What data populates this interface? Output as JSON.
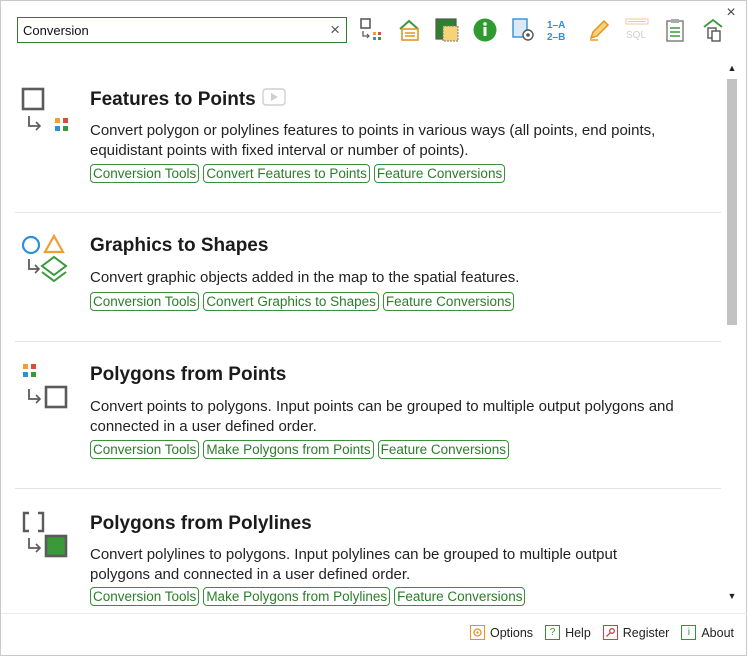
{
  "window": {
    "close_glyph": "×"
  },
  "search": {
    "value": "Conversion",
    "clear_glyph": "×"
  },
  "toolbar": {
    "buttons": [
      {
        "name": "features-to-points-tool-icon"
      },
      {
        "name": "export-layer-icon"
      },
      {
        "name": "map-extent-icon"
      },
      {
        "name": "info-icon"
      },
      {
        "name": "settings-document-icon"
      },
      {
        "name": "numbering-icon",
        "line1": "1–A",
        "line2": "2–B"
      },
      {
        "name": "pencil-edit-icon"
      },
      {
        "name": "sql-icon",
        "text": "SQL"
      },
      {
        "name": "clipboard-icon"
      },
      {
        "name": "copy-layer-icon"
      }
    ]
  },
  "results": [
    {
      "title": "Features to Points",
      "description": "Convert polygon or polylines features to points in various ways (all points, end points, equidistant points with fixed interval or number of points).",
      "tags": [
        "Conversion Tools",
        "Convert Features to Points",
        "Feature Conversions"
      ],
      "icon": "features-to-points-icon",
      "has_video": true
    },
    {
      "title": "Graphics to Shapes",
      "description": "Convert graphic objects added in the map to the spatial features.",
      "tags": [
        "Conversion Tools",
        "Convert Graphics to Shapes",
        "Feature Conversions"
      ],
      "icon": "graphics-to-shapes-icon",
      "has_video": false
    },
    {
      "title": "Polygons from Points",
      "description": "Convert points to polygons. Input points can be grouped to multiple output polygons and connected in a user defined order.",
      "tags": [
        "Conversion Tools",
        "Make Polygons from Points",
        "Feature Conversions"
      ],
      "icon": "polygons-from-points-icon",
      "has_video": false
    },
    {
      "title": "Polygons from Polylines",
      "description": "Convert polylines to polygons. Input polylines can be grouped to multiple output polygons and connected in a user defined order.",
      "tags": [
        "Conversion Tools",
        "Make Polygons from Polylines",
        "Feature Conversions"
      ],
      "icon": "polygons-from-polylines-icon",
      "has_video": false
    }
  ],
  "scrollbar": {
    "up_glyph": "▲",
    "down_glyph": "▼"
  },
  "footer": {
    "options": "Options",
    "help": "Help",
    "register": "Register",
    "about": "About",
    "help_glyph": "?",
    "about_glyph": "i"
  },
  "colors": {
    "accent_green": "#2a7d2a",
    "icon_orange": "#f0a030",
    "icon_blue": "#2f8fd8",
    "icon_red": "#e04a3a",
    "icon_gray": "#5b5b5b"
  }
}
